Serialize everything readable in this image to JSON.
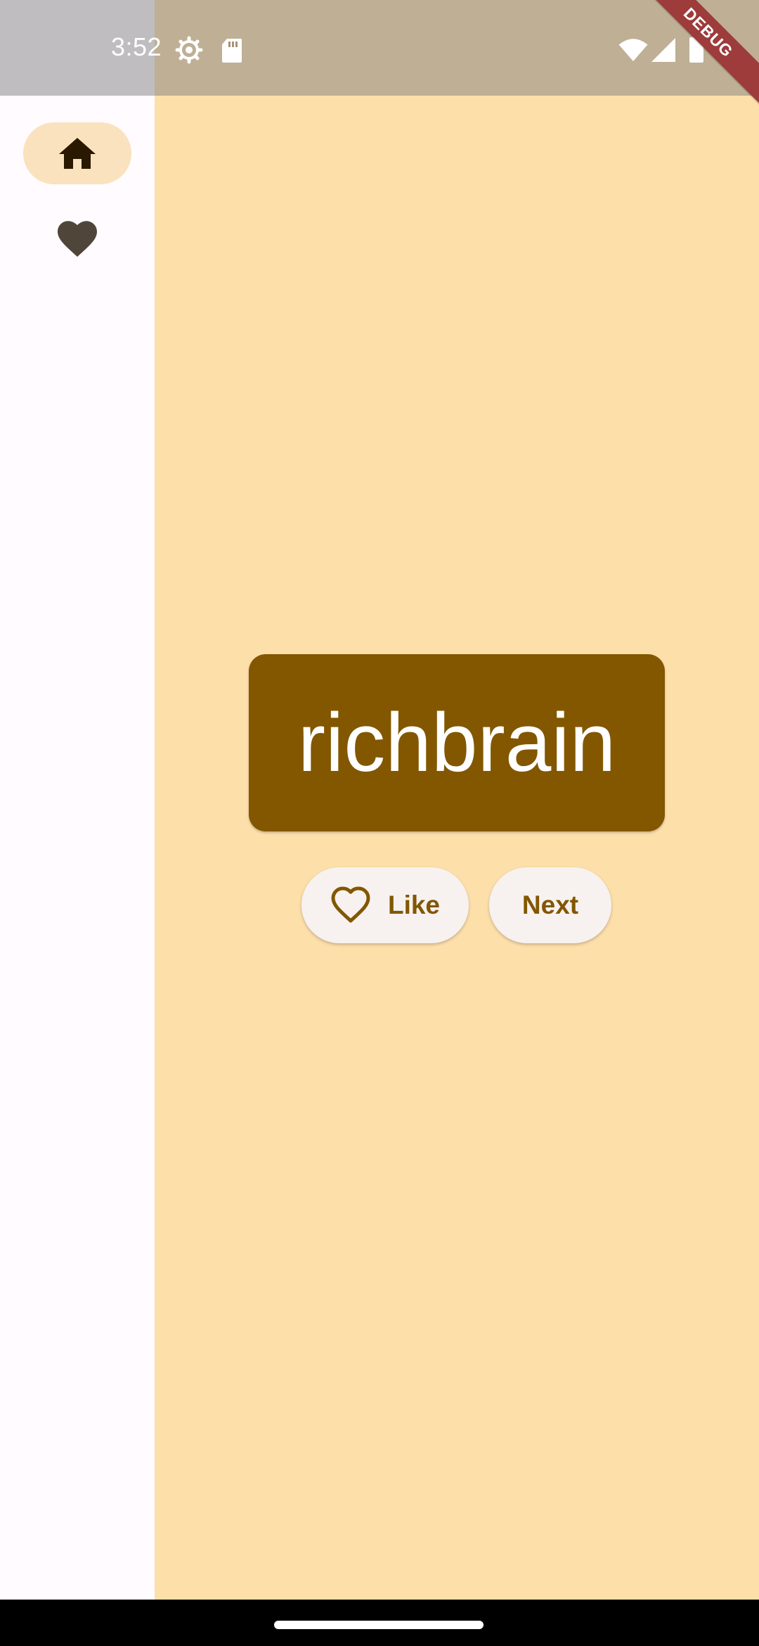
{
  "status_bar": {
    "time": "3:52",
    "icons": [
      "settings-icon",
      "sd-card-icon",
      "wifi-icon",
      "cellular-signal-icon",
      "battery-icon"
    ]
  },
  "debug_banner": "DEBUG",
  "nav_rail": {
    "items": [
      {
        "name": "home",
        "icon": "home-icon",
        "selected": true
      },
      {
        "name": "favorites",
        "icon": "heart-icon",
        "selected": false
      }
    ]
  },
  "main": {
    "word": "richbrain",
    "like_label": "Like",
    "next_label": "Next"
  },
  "colors": {
    "background": "#FDDFAA",
    "rail": "#FFFBFE",
    "rail_indicator": "#F9E2BD",
    "card": "#825700",
    "button_bg": "#F7F2F0",
    "button_text": "#825700"
  }
}
